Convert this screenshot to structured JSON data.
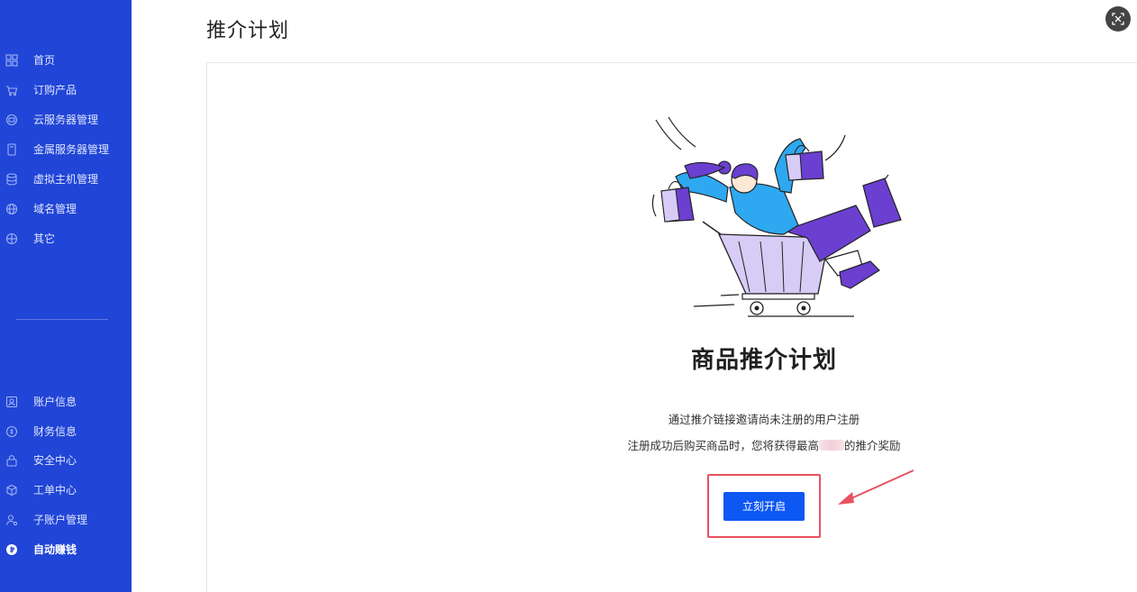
{
  "sidebar": {
    "items": [
      {
        "label": "首页",
        "icon": "grid-icon"
      },
      {
        "label": "订购产品",
        "icon": "cart-icon"
      },
      {
        "label": "云服务器管理",
        "icon": "cloud-server-icon"
      },
      {
        "label": "金属服务器管理",
        "icon": "metal-server-icon"
      },
      {
        "label": "虚拟主机管理",
        "icon": "database-icon"
      },
      {
        "label": "域名管理",
        "icon": "globe-icon"
      },
      {
        "label": "其它",
        "icon": "other-icon"
      }
    ],
    "bottom_items": [
      {
        "label": "账户信息",
        "icon": "user-card-icon"
      },
      {
        "label": "财务信息",
        "icon": "finance-icon"
      },
      {
        "label": "安全中心",
        "icon": "lock-icon"
      },
      {
        "label": "工单中心",
        "icon": "box-icon"
      },
      {
        "label": "子账户管理",
        "icon": "sub-account-icon"
      },
      {
        "label": "自动赚钱",
        "icon": "coin-icon",
        "active": true
      }
    ]
  },
  "header": {
    "title": "推介计划"
  },
  "main": {
    "hero_title": "商品推介计划",
    "desc_line1": "通过推介链接邀请尚未注册的用户注册",
    "desc_line2_before": "注册成功后购买商品时，您将获得最高",
    "desc_line2_after": "的推介奖励",
    "cta_label": "立刻开启"
  },
  "colors": {
    "sidebar_bg": "#2145d6",
    "primary": "#0d57f2",
    "highlight": "#e8525f"
  }
}
